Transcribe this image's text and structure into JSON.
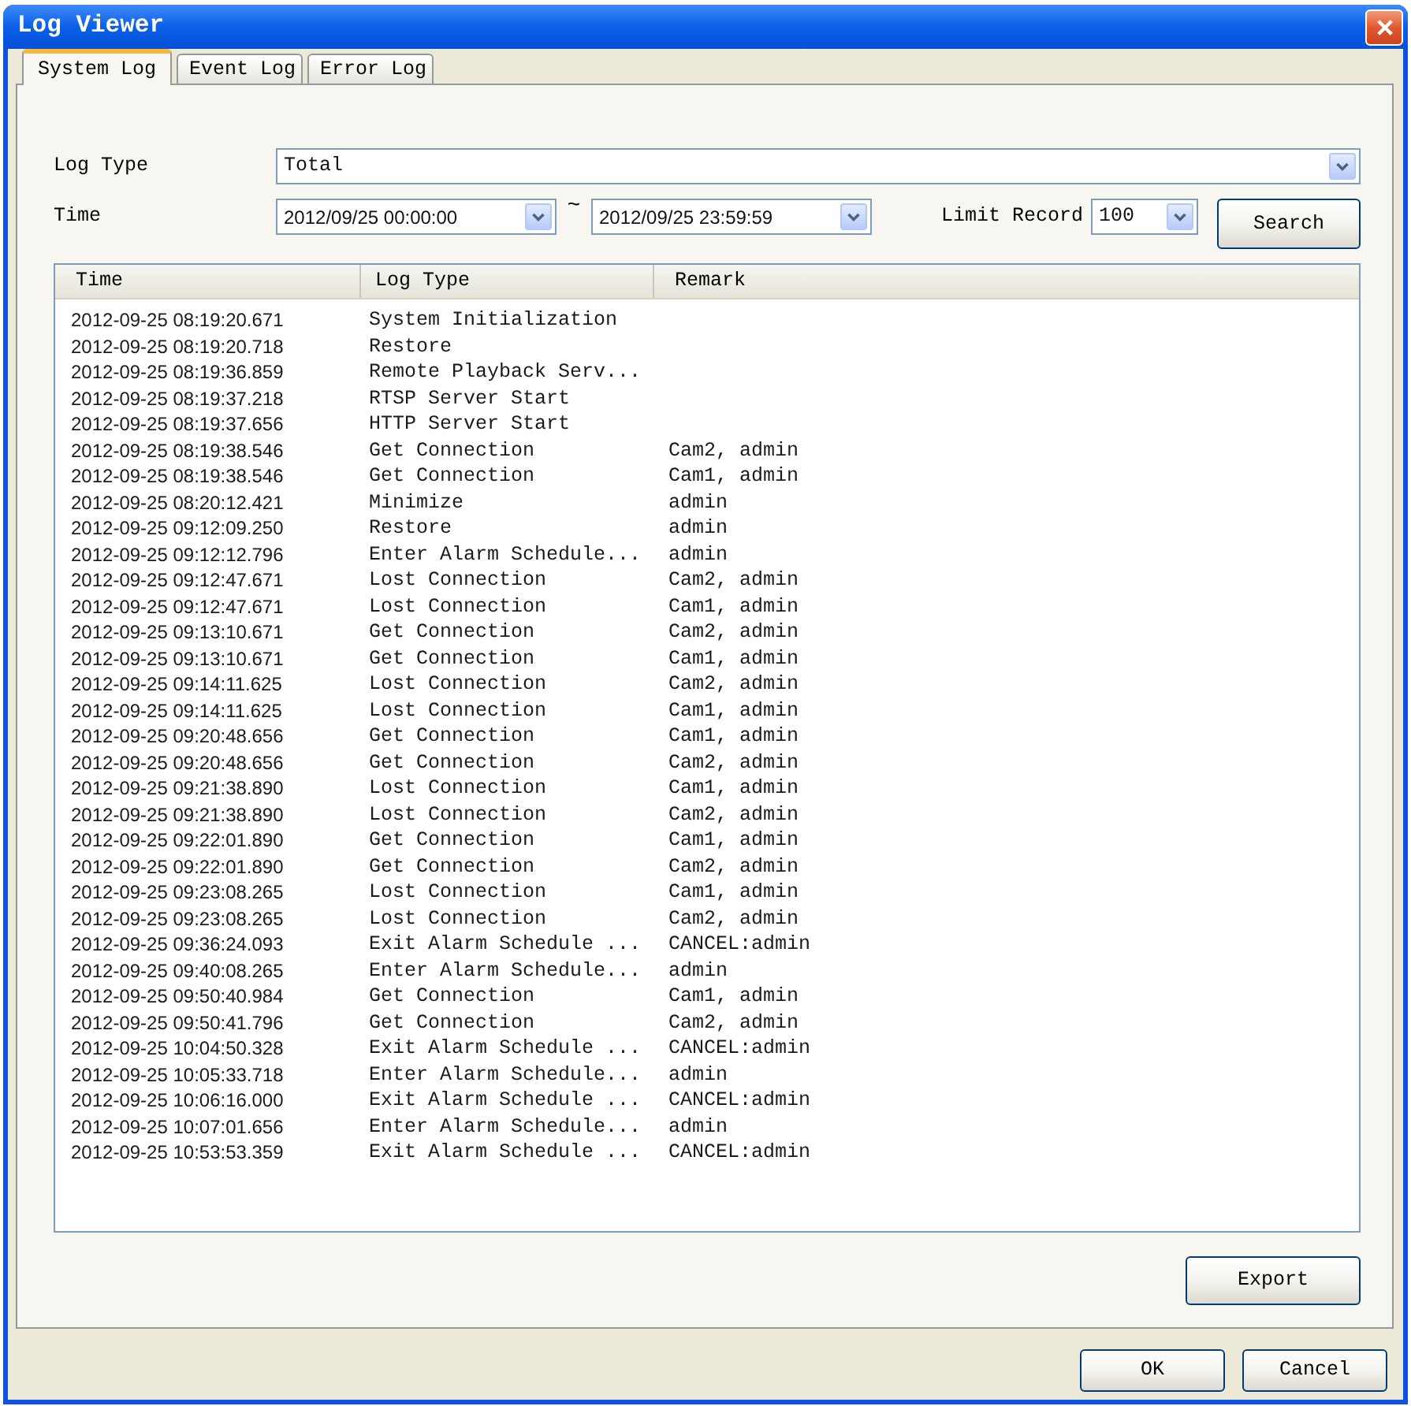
{
  "window": {
    "title": "Log Viewer"
  },
  "tabs": [
    {
      "label": "System Log",
      "selected": true
    },
    {
      "label": "Event Log",
      "selected": false
    },
    {
      "label": "Error Log",
      "selected": false
    }
  ],
  "filters": {
    "log_type": {
      "label": "Log Type",
      "value": "Total"
    },
    "time": {
      "label": "Time",
      "start": "2012/09/25 00:00:00",
      "separator": "~",
      "end": "2012/09/25 23:59:59"
    },
    "limit_record": {
      "label": "Limit Record",
      "value": "100"
    },
    "search_button": "Search"
  },
  "table": {
    "columns": [
      "Time",
      "Log Type",
      "Remark"
    ],
    "rows": [
      {
        "time": "2012-09-25 08:19:20.671",
        "log_type": "System Initialization"
      },
      {
        "time": "2012-09-25 08:19:20.718",
        "log_type": "Restore"
      },
      {
        "time": "2012-09-25 08:19:36.859",
        "log_type": "Remote Playback Serv..."
      },
      {
        "time": "2012-09-25 08:19:37.218",
        "log_type": "RTSP Server Start"
      },
      {
        "time": "2012-09-25 08:19:37.656",
        "log_type": "HTTP Server Start"
      },
      {
        "time": "2012-09-25 08:19:38.546",
        "log_type": "Get Connection",
        "remark": "Cam2, admin"
      },
      {
        "time": "2012-09-25 08:19:38.546",
        "log_type": "Get Connection",
        "remark": "Cam1, admin"
      },
      {
        "time": "2012-09-25 08:20:12.421",
        "log_type": "Minimize",
        "remark": "admin"
      },
      {
        "time": "2012-09-25 09:12:09.250",
        "log_type": "Restore",
        "remark": "admin"
      },
      {
        "time": "2012-09-25 09:12:12.796",
        "log_type": "Enter Alarm Schedule...",
        "remark": "admin"
      },
      {
        "time": "2012-09-25 09:12:47.671",
        "log_type": "Lost Connection",
        "remark": "Cam2, admin"
      },
      {
        "time": "2012-09-25 09:12:47.671",
        "log_type": "Lost Connection",
        "remark": "Cam1, admin"
      },
      {
        "time": "2012-09-25 09:13:10.671",
        "log_type": "Get Connection",
        "remark": "Cam2, admin"
      },
      {
        "time": "2012-09-25 09:13:10.671",
        "log_type": "Get Connection",
        "remark": "Cam1, admin"
      },
      {
        "time": "2012-09-25 09:14:11.625",
        "log_type": "Lost Connection",
        "remark": "Cam2, admin"
      },
      {
        "time": "2012-09-25 09:14:11.625",
        "log_type": "Lost Connection",
        "remark": "Cam1, admin"
      },
      {
        "time": "2012-09-25 09:20:48.656",
        "log_type": "Get Connection",
        "remark": "Cam1, admin"
      },
      {
        "time": "2012-09-25 09:20:48.656",
        "log_type": "Get Connection",
        "remark": "Cam2, admin"
      },
      {
        "time": "2012-09-25 09:21:38.890",
        "log_type": "Lost Connection",
        "remark": "Cam1, admin"
      },
      {
        "time": "2012-09-25 09:21:38.890",
        "log_type": "Lost Connection",
        "remark": "Cam2, admin"
      },
      {
        "time": "2012-09-25 09:22:01.890",
        "log_type": "Get Connection",
        "remark": "Cam1, admin"
      },
      {
        "time": "2012-09-25 09:22:01.890",
        "log_type": "Get Connection",
        "remark": "Cam2, admin"
      },
      {
        "time": "2012-09-25 09:23:08.265",
        "log_type": "Lost Connection",
        "remark": "Cam1, admin"
      },
      {
        "time": "2012-09-25 09:23:08.265",
        "log_type": "Lost Connection",
        "remark": "Cam2, admin"
      },
      {
        "time": "2012-09-25 09:36:24.093",
        "log_type": "Exit Alarm Schedule ...",
        "remark": "CANCEL:admin"
      },
      {
        "time": "2012-09-25 09:40:08.265",
        "log_type": "Enter Alarm Schedule...",
        "remark": "admin"
      },
      {
        "time": "2012-09-25 09:50:40.984",
        "log_type": "Get Connection",
        "remark": "Cam1, admin"
      },
      {
        "time": "2012-09-25 09:50:41.796",
        "log_type": "Get Connection",
        "remark": "Cam2, admin"
      },
      {
        "time": "2012-09-25 10:04:50.328",
        "log_type": "Exit Alarm Schedule ...",
        "remark": "CANCEL:admin"
      },
      {
        "time": "2012-09-25 10:05:33.718",
        "log_type": "Enter Alarm Schedule...",
        "remark": "admin"
      },
      {
        "time": "2012-09-25 10:06:16.000",
        "log_type": "Exit Alarm Schedule ...",
        "remark": "CANCEL:admin"
      },
      {
        "time": "2012-09-25 10:07:01.656",
        "log_type": "Enter Alarm Schedule...",
        "remark": "admin"
      },
      {
        "time": "2012-09-25 10:53:53.359",
        "log_type": "Exit Alarm Schedule ...",
        "remark": "CANCEL:admin"
      }
    ]
  },
  "export_button": "Export",
  "buttons": [
    "OK",
    "Cancel"
  ]
}
